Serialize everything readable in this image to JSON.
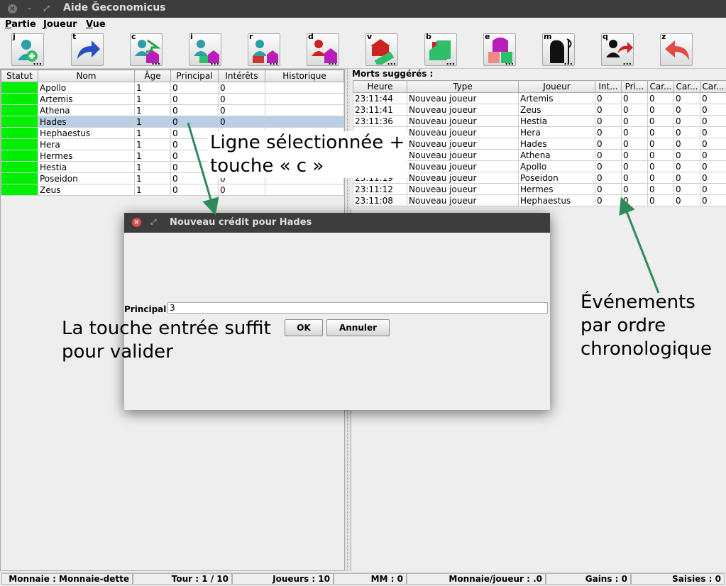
{
  "window": {
    "title": "Aide Ğeconomicus",
    "close_glyph": "×",
    "min_glyph": "–",
    "restore_glyph": "⤢"
  },
  "menu": [
    "Partie",
    "Joueur",
    "Vue"
  ],
  "toolbar": [
    {
      "key": "j",
      "icon": "new-player-icon",
      "dots": "..."
    },
    {
      "key": "t",
      "icon": "next-turn-arrow-icon",
      "dots": ""
    },
    {
      "key": "c",
      "icon": "credit-return-icon",
      "dots": "..."
    },
    {
      "key": "i",
      "icon": "interest-bank-icon",
      "dots": "..."
    },
    {
      "key": "r",
      "icon": "repay-bank-icon",
      "dots": "..."
    },
    {
      "key": "d",
      "icon": "default-bank-icon",
      "dots": "..."
    },
    {
      "key": "v",
      "icon": "bank-money-icon",
      "dots": "..."
    },
    {
      "key": "b",
      "icon": "bank-cards-icon",
      "dots": "..."
    },
    {
      "key": "e",
      "icon": "exchange-cards-icon",
      "dots": "..."
    },
    {
      "key": "m",
      "icon": "death-reaper-icon",
      "dots": "..."
    },
    {
      "key": "q",
      "icon": "player-quit-icon",
      "dots": "..."
    },
    {
      "key": "z",
      "icon": "undo-arrow-icon",
      "dots": ""
    }
  ],
  "players_table": {
    "headers": [
      "Statut",
      "Nom",
      "Âge",
      "Principal",
      "Intérêts",
      "Historique"
    ],
    "selected_index": 3,
    "rows": [
      {
        "nom": "Apollo",
        "age": "1",
        "principal": "0",
        "interets": "0",
        "historique": ""
      },
      {
        "nom": "Artemis",
        "age": "1",
        "principal": "0",
        "interets": "0",
        "historique": ""
      },
      {
        "nom": "Athena",
        "age": "1",
        "principal": "0",
        "interets": "0",
        "historique": ""
      },
      {
        "nom": "Hades",
        "age": "1",
        "principal": "0",
        "interets": "0",
        "historique": ""
      },
      {
        "nom": "Hephaestus",
        "age": "1",
        "principal": "0",
        "interets": "",
        "historique": ""
      },
      {
        "nom": "Hera",
        "age": "1",
        "principal": "0",
        "interets": "",
        "historique": ""
      },
      {
        "nom": "Hermes",
        "age": "1",
        "principal": "0",
        "interets": "",
        "historique": ""
      },
      {
        "nom": "Hestia",
        "age": "1",
        "principal": "0",
        "interets": "",
        "historique": ""
      },
      {
        "nom": "Poseidon",
        "age": "1",
        "principal": "0",
        "interets": "0",
        "historique": ""
      },
      {
        "nom": "Zeus",
        "age": "1",
        "principal": "0",
        "interets": "0",
        "historique": ""
      }
    ],
    "status_color": "#00ee00"
  },
  "events": {
    "title": "Morts suggérés :",
    "headers": [
      "Heure",
      "Type",
      "Joueur",
      "Int...",
      "Pri...",
      "Car...",
      "Car...",
      "Car..."
    ],
    "rows": [
      [
        "23:11:44",
        "Nouveau joueur",
        "Artemis",
        "0",
        "0",
        "0",
        "0",
        "0"
      ],
      [
        "23:11:41",
        "Nouveau joueur",
        "Zeus",
        "0",
        "0",
        "0",
        "0",
        "0"
      ],
      [
        "23:11:36",
        "Nouveau joueur",
        "Hestia",
        "0",
        "0",
        "0",
        "0",
        "0"
      ],
      [
        "",
        "Nouveau joueur",
        "Hera",
        "0",
        "0",
        "0",
        "0",
        "0"
      ],
      [
        "",
        "Nouveau joueur",
        "Hades",
        "0",
        "0",
        "0",
        "0",
        "0"
      ],
      [
        "",
        "Nouveau joueur",
        "Athena",
        "0",
        "0",
        "0",
        "0",
        "0"
      ],
      [
        "",
        "Nouveau joueur",
        "Apollo",
        "0",
        "0",
        "0",
        "0",
        "0"
      ],
      [
        "23:11:19",
        "Nouveau joueur",
        "Poseidon",
        "0",
        "0",
        "0",
        "0",
        "0"
      ],
      [
        "23:11:12",
        "Nouveau joueur",
        "Hermes",
        "0",
        "0",
        "0",
        "0",
        "0"
      ],
      [
        "23:11:08",
        "Nouveau joueur",
        "Hephaestus",
        "0",
        "0",
        "0",
        "0",
        "0"
      ]
    ]
  },
  "dialog": {
    "title": "Nouveau crédit pour Hades",
    "label": "Principal",
    "value": "3",
    "ok": "OK",
    "cancel": "Annuler"
  },
  "annotations": {
    "selection": [
      "Ligne sélectionnée +",
      "touche « c »"
    ],
    "enter": [
      "La touche entrée suffit",
      "pour valider"
    ],
    "events": [
      "Événements",
      "par ordre",
      "chronologique"
    ],
    "arrow_color": "#2e8a5a"
  },
  "statusbar": [
    "Monnaie : Monnaie-dette",
    "Tour : 1 / 10",
    "Joueurs : 10",
    "MM : 0",
    "Monnaie/joueur : .0",
    "Gains : 0",
    "Saisies : 0"
  ]
}
